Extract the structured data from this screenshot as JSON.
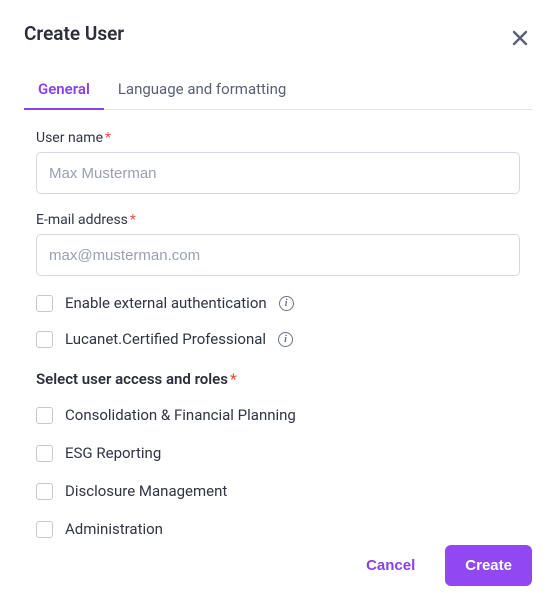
{
  "modal": {
    "title": "Create User"
  },
  "tabs": {
    "general": "General",
    "language": "Language and formatting"
  },
  "fields": {
    "username": {
      "label": "User name",
      "placeholder": "Max Musterman",
      "value": ""
    },
    "email": {
      "label": "E-mail address",
      "placeholder": "max@musterman.com",
      "value": ""
    }
  },
  "options": {
    "external_auth": "Enable external authentication",
    "certified": "Lucanet.Certified Professional"
  },
  "roles": {
    "heading": "Select user access and roles",
    "items": [
      "Consolidation & Financial Planning",
      "ESG Reporting",
      "Disclosure Management",
      "Administration"
    ]
  },
  "footer": {
    "cancel": "Cancel",
    "create": "Create"
  }
}
